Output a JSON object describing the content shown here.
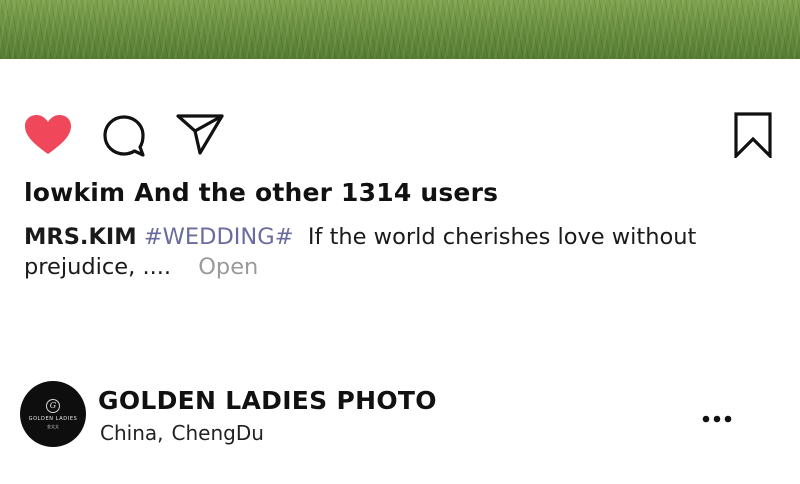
{
  "post": {
    "likes_text": "lowkim And the other 1314 users",
    "caption": {
      "author": "MRS.KIM",
      "hashtag": "#WEDDING#",
      "text_line1": "If the world cherishes love without",
      "text_line2": "prejudice, ....",
      "open_label": "Open"
    },
    "actions": {
      "like_icon": "heart-filled-icon",
      "comment_icon": "comment-bubble-icon",
      "share_icon": "paper-plane-icon",
      "save_icon": "bookmark-icon",
      "like_color": "#f0475a"
    }
  },
  "account": {
    "name": "GOLDEN LADIES PHOTO",
    "location_country": "China,",
    "location_city": "ChengDu",
    "avatar": {
      "monogram": "G",
      "brand_text": "GOLDEN LADIES",
      "brand_sub": "金太太"
    },
    "more_icon": "more-dots-icon"
  }
}
